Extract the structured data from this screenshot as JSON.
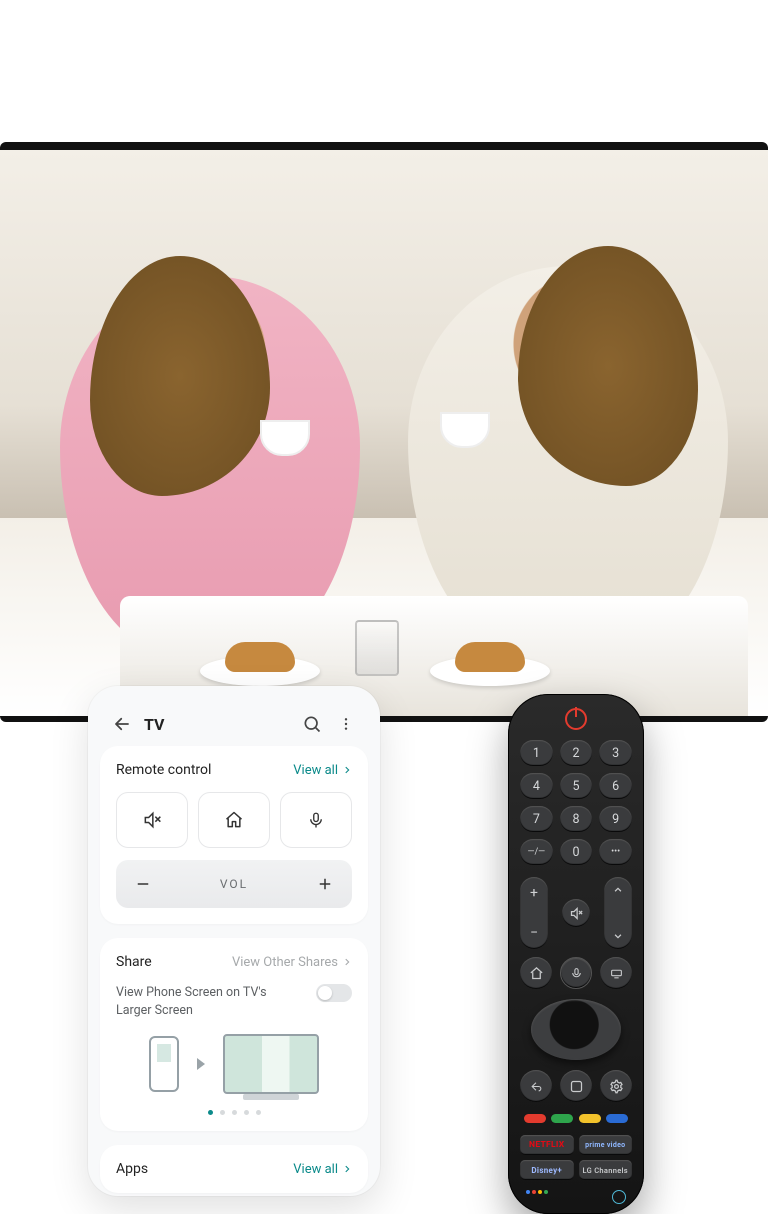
{
  "phone": {
    "title": "TV",
    "remote_control": {
      "title": "Remote control",
      "view_all": "View all",
      "vol_label": "VOL"
    },
    "share": {
      "title": "Share",
      "view_other": "View Other Shares",
      "cast_text": "View Phone Screen on TV's Larger Screen"
    },
    "apps": {
      "title": "Apps",
      "view_all": "View all"
    }
  },
  "remote": {
    "numpad": [
      "1",
      "2",
      "3",
      "4",
      "5",
      "6",
      "7",
      "8",
      "9",
      "—/—",
      "0",
      "•••"
    ],
    "apps": {
      "netflix": "NETFLIX",
      "prime": "prime video",
      "disney": "Disney+",
      "lg_channels": "LG Channels"
    }
  }
}
